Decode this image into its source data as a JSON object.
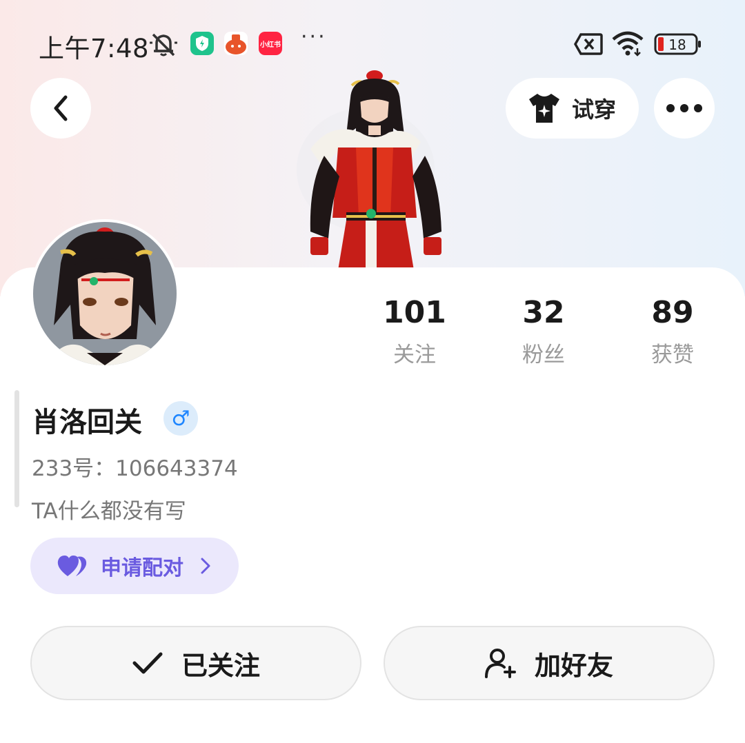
{
  "status_bar": {
    "time": "上午7:48",
    "app3_label": "小红书",
    "more": "···",
    "battery": "18",
    "icons": [
      "bell-muted-icon",
      "shield-app-icon",
      "game-app-icon",
      "xiaohongshu-app-icon",
      "sim-off-icon",
      "wifi-icon",
      "battery-icon"
    ]
  },
  "header": {
    "back_icon": "back-chevron-icon",
    "try_on_label": "试穿",
    "try_on_icon": "tshirt-icon",
    "more_icon": "more-dots-icon"
  },
  "stats": [
    {
      "value": "101",
      "label": "关注"
    },
    {
      "value": "32",
      "label": "粉丝"
    },
    {
      "value": "89",
      "label": "获赞"
    }
  ],
  "profile": {
    "nickname": "肖洛回关",
    "gender_symbol": "♂",
    "uid": "233号：106643374",
    "bio": "TA什么都没有写"
  },
  "pair_button": {
    "label": "申请配对",
    "icon": "hearts-icon"
  },
  "actions": {
    "follow_label": "已关注",
    "friend_label": "加好友"
  },
  "colors": {
    "accent_purple": "#6a5be0",
    "pair_bg": "#ebe8fc",
    "gender_blue": "#1e86ff"
  }
}
